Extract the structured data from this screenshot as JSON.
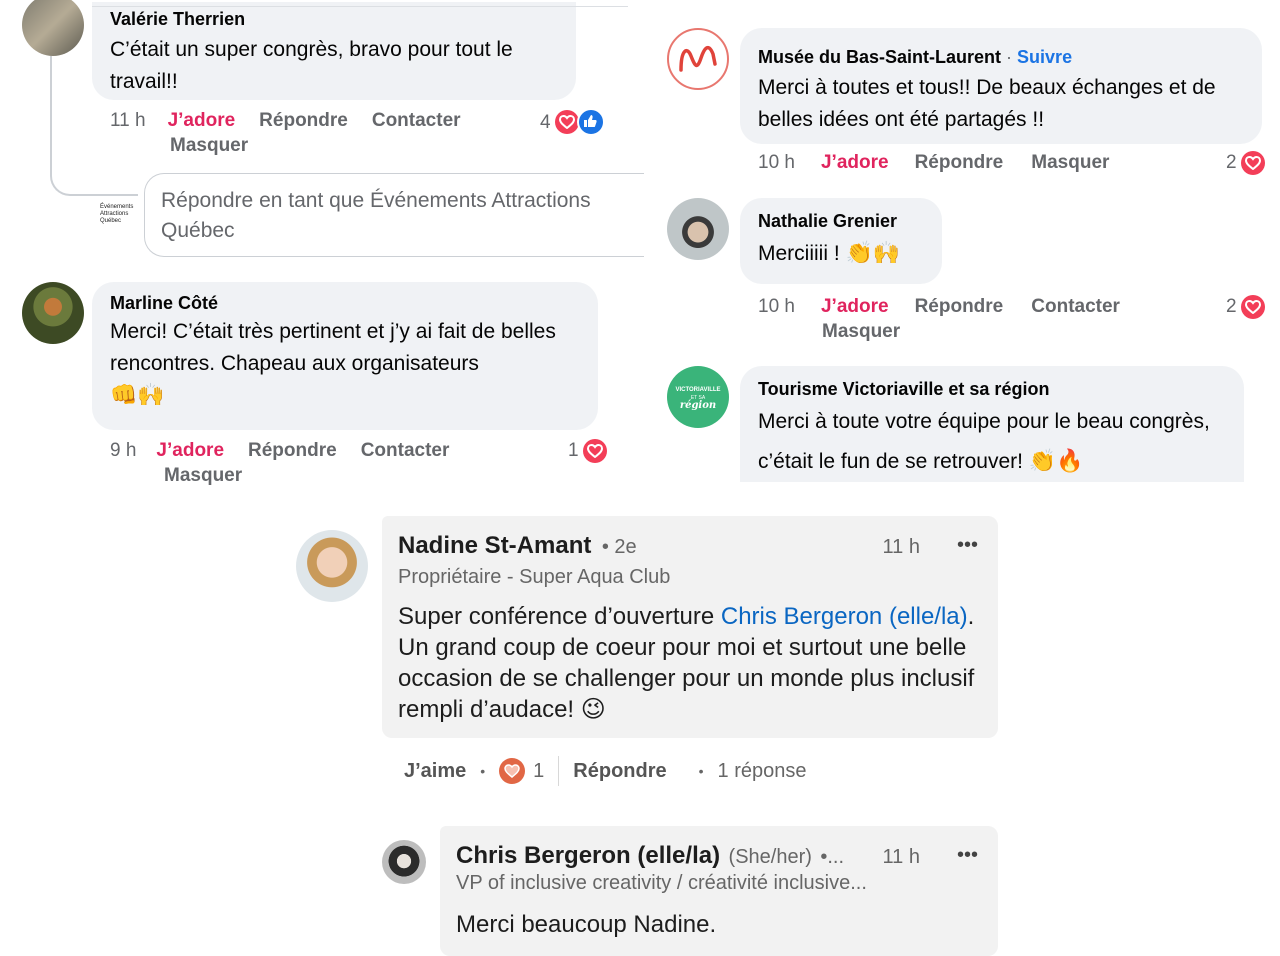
{
  "left": {
    "c1": {
      "name": "Valérie Therrien",
      "text": "C’était un super congrès, bravo pour tout le travail!!",
      "time": "11 h",
      "love": "J’adore",
      "reply": "Répondre",
      "contact": "Contacter",
      "hide": "Masquer",
      "count": "4"
    },
    "reply_box": {
      "placeholder": "Répondre en tant que Événements Attractions Québec",
      "logo_text": "Événements Attractions Québec"
    },
    "c2": {
      "name": "Marline Côté",
      "text": "Merci! C’était très pertinent et j’y ai fait de belles rencontres. Chapeau aux organisateurs",
      "emoji": "👊🙌",
      "time": "9 h",
      "love": "J’adore",
      "reply": "Répondre",
      "contact": "Contacter",
      "hide": "Masquer",
      "count": "1"
    }
  },
  "right": {
    "c1": {
      "name": "Musée du Bas-Saint-Laurent",
      "sep": " · ",
      "follow": "Suivre",
      "text": "Merci à toutes et tous!! De beaux échanges et de belles idées ont été partagés !!",
      "time": "10 h",
      "love": "J’adore",
      "reply": "Répondre",
      "hide": "Masquer",
      "count": "2"
    },
    "c2": {
      "name": "Nathalie Grenier",
      "text": "Merciiiii !",
      "emoji": "👏🙌",
      "time": "10 h",
      "love": "J’adore",
      "reply": "Répondre",
      "contact": "Contacter",
      "hide": "Masquer",
      "count": "2"
    },
    "c3": {
      "name": "Tourisme Victoriaville et sa région",
      "text": "Merci à toute votre équipe pour le beau congrès, c’était le fun de se retrouver!",
      "emoji": "👏🔥",
      "avatar_text_top": "VICTORIAVILLE",
      "avatar_text_bottom": "région",
      "avatar_text_mid": "ET SA"
    }
  },
  "linkedin": {
    "post": {
      "name": "Nadine St-Amant",
      "degree": "• 2e",
      "time": "11 h",
      "more": "•••",
      "headline": "Propriétaire - Super Aqua Club",
      "text_before": "Super conférence d’ouverture ",
      "mention": "Chris Bergeron (elle/la)",
      "text_after": ". Un grand coup de coeur pour moi et surtout une belle occasion de se challenger pour un monde plus inclusif rempli d’audace!",
      "emoji": "😉",
      "like": "J’aime",
      "dot": "•",
      "reaction_count": "1",
      "reply": "Répondre",
      "replies": "1 réponse"
    },
    "reply": {
      "name": "Chris Bergeron (elle/la)",
      "pronouns": "(She/her)",
      "trail": "•...",
      "time": "11 h",
      "more": "•••",
      "headline": "VP of inclusive creativity / créativité inclusive...",
      "text": "Merci beaucoup Nadine."
    }
  },
  "colors": {
    "love": "#e0245e",
    "heart": "#f33e58",
    "like": "#1b74e4",
    "link": "#0a66c2",
    "bubble": "#f0f2f5"
  }
}
